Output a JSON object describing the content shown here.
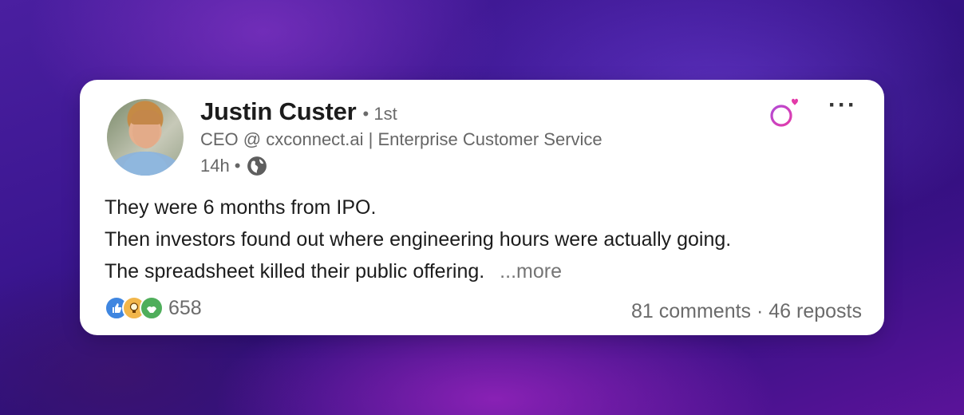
{
  "author": {
    "name": "Justin Custer",
    "separator": "•",
    "degree": "1st",
    "headline": "CEO @ cxconnect.ai | Enterprise Customer Service",
    "time": "14h",
    "time_separator": "•",
    "visibility_icon": "globe-icon"
  },
  "post": {
    "lines": [
      "They were 6 months from IPO.",
      "Then investors found out where engineering hours were actually going.",
      "The spreadsheet killed their public offering."
    ],
    "more_label": "...more"
  },
  "engagement": {
    "reaction_icons": [
      "like-icon",
      "insightful-icon",
      "support-icon"
    ],
    "reaction_count": "658",
    "stats": "81 comments · 46 reposts"
  },
  "toolbar": {
    "menu_label": "···",
    "brand_icon": "female-symbol-heart-icon"
  },
  "colors": {
    "like": "#3f86e0",
    "insight": "#f2b64a",
    "support": "#4fae5b",
    "brand_gradient_start": "#b24ad6",
    "brand_gradient_end": "#e33aa8"
  }
}
